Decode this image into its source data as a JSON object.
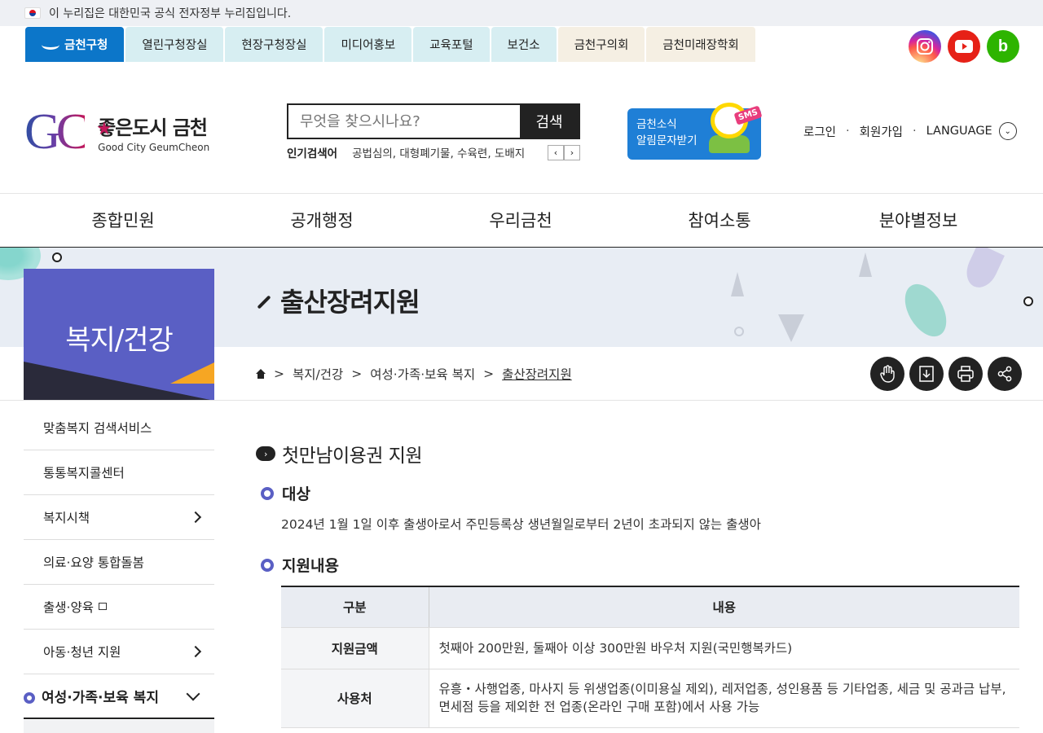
{
  "gov_banner": {
    "text": "이 누리집은 대한민국 공식 전자정부 누리집입니다."
  },
  "site_tabs": [
    {
      "label": "금천구청"
    },
    {
      "label": "열린구청장실"
    },
    {
      "label": "현장구청장실"
    },
    {
      "label": "미디어홍보"
    },
    {
      "label": "교육포털"
    },
    {
      "label": "보건소"
    },
    {
      "label": "금천구의회"
    },
    {
      "label": "금천미래장학회"
    }
  ],
  "social": {
    "blog_letter": "b"
  },
  "logo": {
    "mark": "GC",
    "name_kr": "좋은도시 금천",
    "name_en": "Good City GeumCheon"
  },
  "search": {
    "placeholder": "무엇을 찾으시나요?",
    "button": "검색"
  },
  "popular": {
    "label": "인기검색어",
    "items": "공법심의, 대형폐기물, 수육련, 도배지"
  },
  "sms_banner": {
    "line1": "금천소식",
    "line2": "알림문자받기",
    "tag": "SMS"
  },
  "util": {
    "login": "로그인",
    "signup": "회원가입",
    "language": "LANGUAGE"
  },
  "gnb": [
    {
      "label": "종합민원"
    },
    {
      "label": "공개행정"
    },
    {
      "label": "우리금천"
    },
    {
      "label": "참여소통"
    },
    {
      "label": "분야별정보"
    }
  ],
  "page_title": "출산장려지원",
  "lnb_title": "복지/건강",
  "breadcrumb": [
    "복지/건강",
    "여성·가족·보육 복지",
    "출산장려지원"
  ],
  "lnb": [
    {
      "label": "맞춤복지 검색서비스"
    },
    {
      "label": "통통복지콜센터"
    },
    {
      "label": "복지시책"
    },
    {
      "label": "의료·요양 통합돌봄"
    },
    {
      "label": "출생·양육"
    },
    {
      "label": "아동·청년 지원"
    },
    {
      "label": "여성·가족·보육 복지"
    }
  ],
  "content": {
    "section_title": "첫만남이용권 지원",
    "target_heading": "대상",
    "target_text": "2024년 1월 1일 이후 출생아로서 주민등록상 생년월일로부터 2년이 초과되지 않는 출생아",
    "support_heading": "지원내용",
    "table": {
      "headers": [
        "구분",
        "내용"
      ],
      "rows": [
        {
          "label": "지원금액",
          "content": "첫째아 200만원, 둘째아 이상 300만원 바우처 지원(국민행복카드)"
        },
        {
          "label": "사용처",
          "content": "유흥・사행업종, 마사지 등 위생업종(이미용실 제외), 레저업종, 성인용품 등 기타업종, 세금 및 공과금 납부, 면세점 등을 제외한 전 업종(온라인 구매 포함)에서 사용 가능"
        }
      ]
    }
  }
}
